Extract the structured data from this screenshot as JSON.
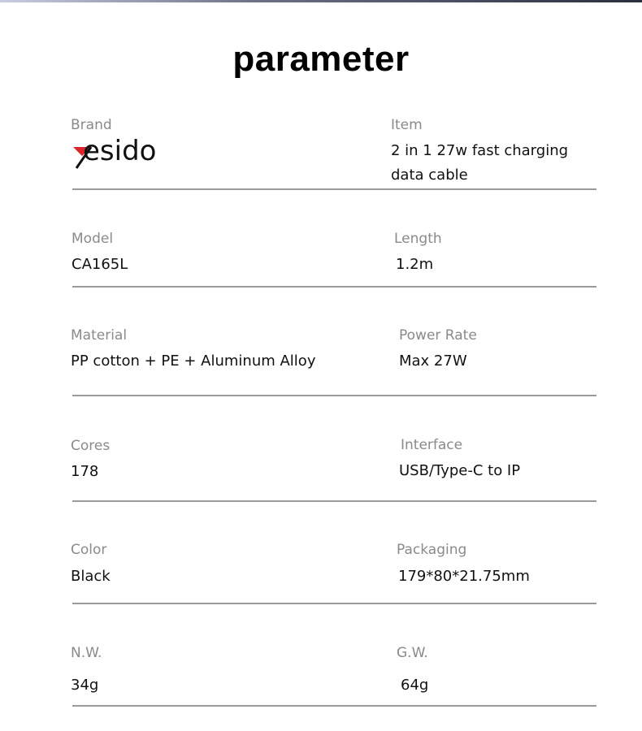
{
  "header": {
    "title": "parameter"
  },
  "brand": {
    "label": "Brand",
    "logo_text": "esido",
    "logo_initial": "y",
    "logo_accent_color": "#d9252b"
  },
  "rows": [
    {
      "left": {
        "label": "Brand",
        "value": ""
      },
      "right": {
        "label": "Item",
        "value_lines": [
          "2 in 1 27w fast charging",
          "data cable"
        ]
      }
    },
    {
      "left": {
        "label": "Model",
        "value": "CA165L"
      },
      "right": {
        "label": "Length",
        "value": "1.2m"
      }
    },
    {
      "left": {
        "label": "Material",
        "value": "PP cotton  + PE + Aluminum Alloy"
      },
      "right": {
        "label": "Power Rate",
        "value": "Max 27W"
      }
    },
    {
      "left": {
        "label": "Cores",
        "value": "178"
      },
      "right": {
        "label": "Interface",
        "value": "USB/Type-C to IP"
      }
    },
    {
      "left": {
        "label": "Color",
        "value": "Black"
      },
      "right": {
        "label": "Packaging",
        "value": "179*80*21.75mm"
      }
    },
    {
      "left": {
        "label": "N.W.",
        "value": "34g"
      },
      "right": {
        "label": "G.W.",
        "value": "64g"
      }
    }
  ]
}
